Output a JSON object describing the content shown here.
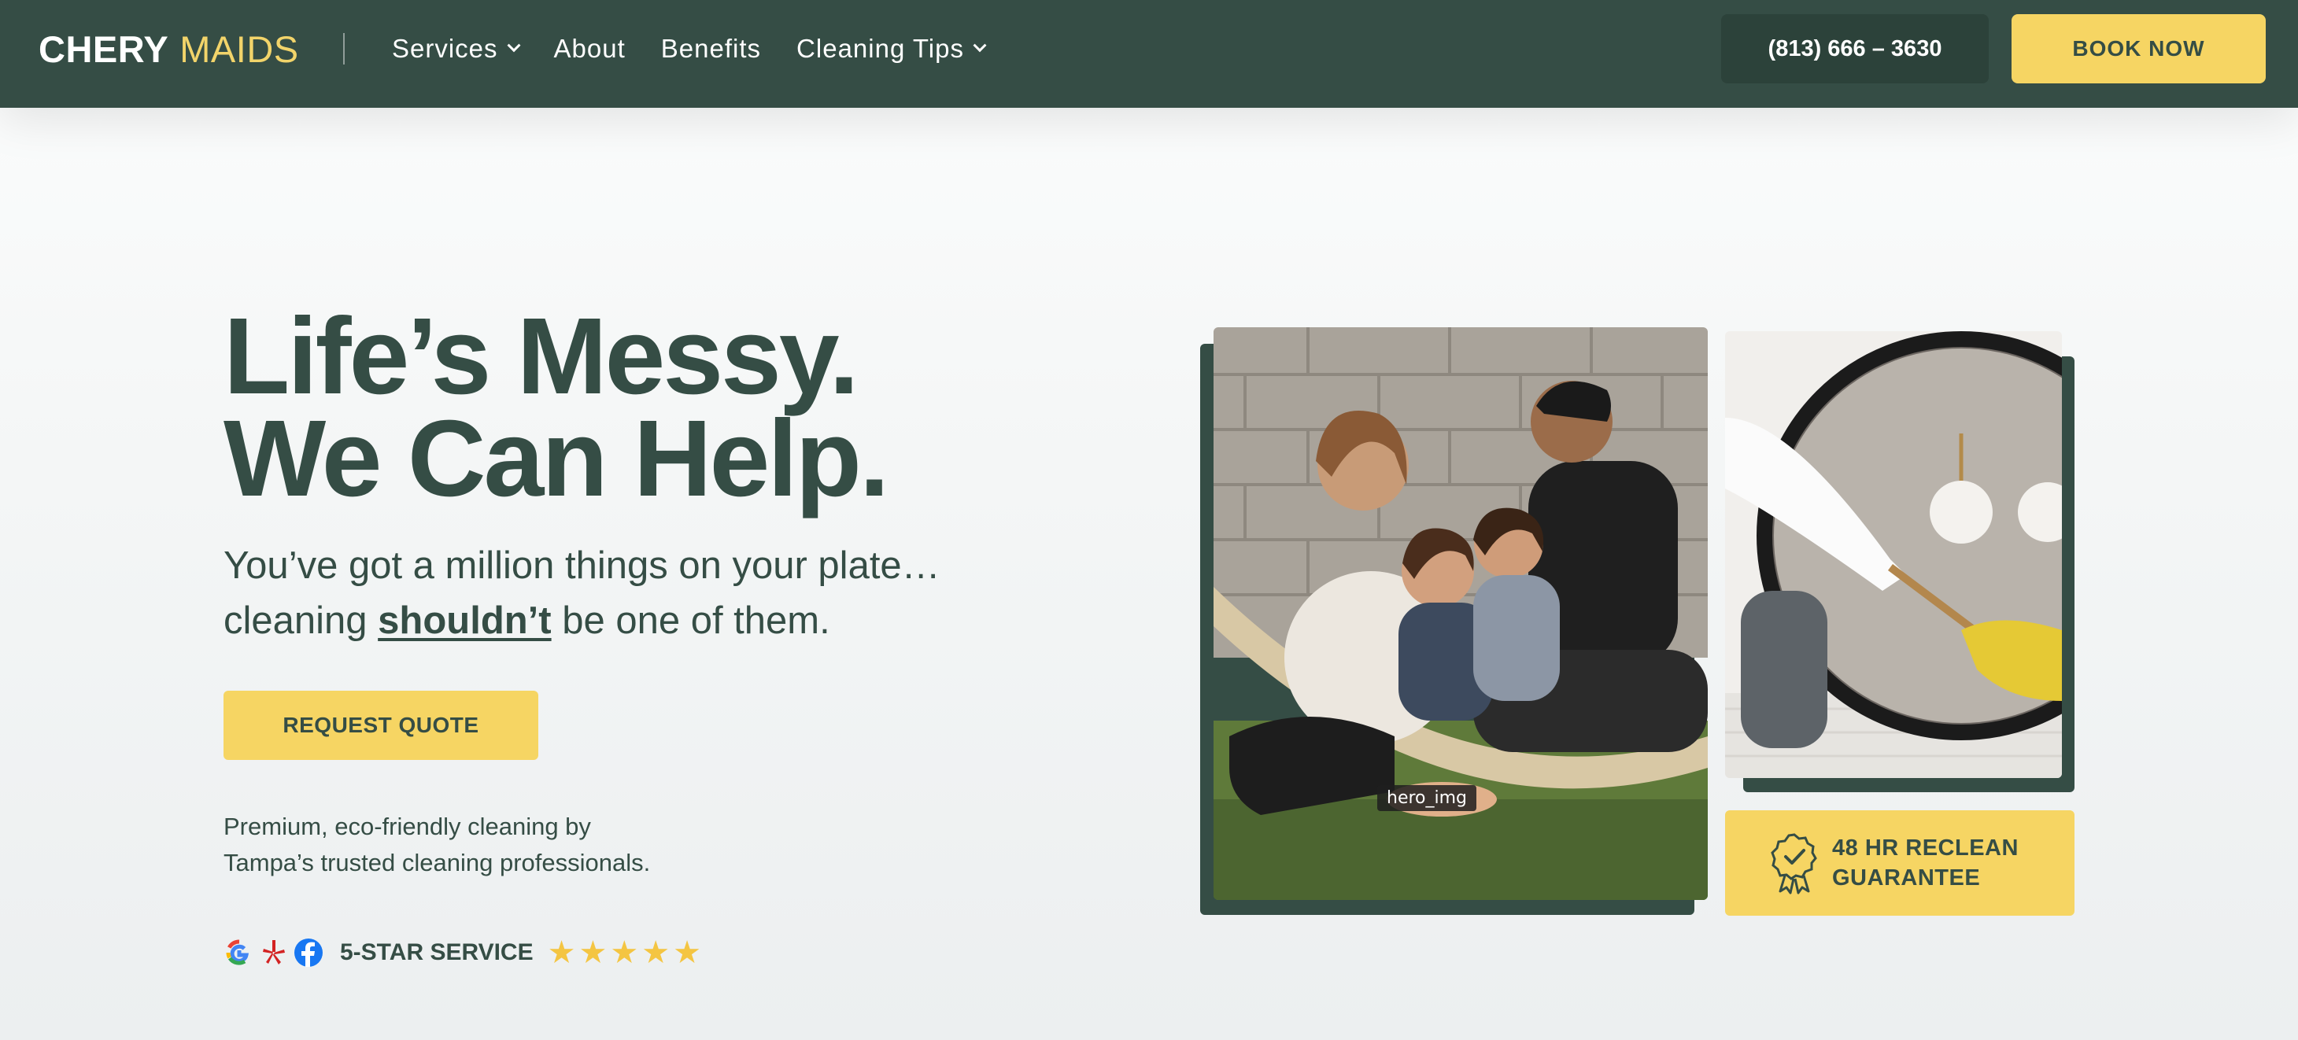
{
  "brand": {
    "part1": "CHERY",
    "part2": "MAIDS",
    "colors": {
      "primary": "#354d45",
      "accent": "#f6d563",
      "dark": "#2c423a"
    }
  },
  "nav": {
    "items": [
      {
        "label": "Services",
        "dropdown": true
      },
      {
        "label": "About",
        "dropdown": false
      },
      {
        "label": "Benefits",
        "dropdown": false
      },
      {
        "label": "Cleaning Tips",
        "dropdown": true
      }
    ],
    "phone": "(813) 666 – 3630",
    "cta": "BOOK NOW"
  },
  "hero": {
    "title_line1": "Life’s Messy.",
    "title_line2": "We Can Help.",
    "sub_line1": "You’ve got a million things on your plate…",
    "sub_line2_pre": "cleaning ",
    "sub_line2_emph": "shouldn’t",
    "sub_line2_post": " be one of them.",
    "cta": "REQUEST QUOTE",
    "desc_line1": "Premium, eco-friendly cleaning by",
    "desc_line2": "Tampa’s trusted cleaning professionals.",
    "rating_label": "5-STAR SERVICE",
    "rating_value": 5,
    "review_icons": [
      "google-icon",
      "yelp-icon",
      "facebook-icon"
    ],
    "image_caption": "hero_img",
    "guarantee_line1": "48 HR RECLEAN",
    "guarantee_line2": "GUARANTEE"
  }
}
